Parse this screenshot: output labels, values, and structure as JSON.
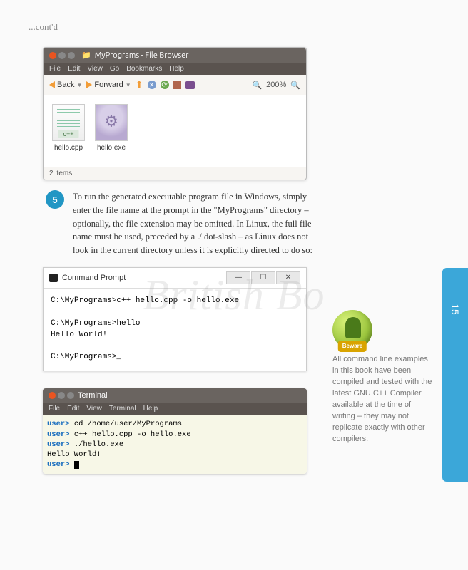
{
  "contd": "...cont'd",
  "page_number": "15",
  "filebrowser": {
    "title": "MyPrograms - File Browser",
    "menu": [
      "File",
      "Edit",
      "View",
      "Go",
      "Bookmarks",
      "Help"
    ],
    "toolbar": {
      "back": "Back",
      "forward": "Forward",
      "zoom_level": "200%"
    },
    "files": [
      {
        "name": "hello.cpp",
        "type": "cpp"
      },
      {
        "name": "hello.exe",
        "type": "exe"
      }
    ],
    "status": "2 items"
  },
  "step": {
    "number": "5",
    "text": "To run the generated executable program file in Windows, simply enter the file name at the prompt in the \"MyPrograms\" directory – optionally, the file extension may be omitted. In Linux, the full file name must be used, preceded by a ./ dot-slash – as Linux does not look in the current directory unless it is explicitly directed to do so:"
  },
  "cmdprompt": {
    "title": "Command Prompt",
    "lines": [
      "C:\\MyPrograms>c++ hello.cpp -o hello.exe",
      "",
      "C:\\MyPrograms>hello",
      "Hello World!",
      "",
      "C:\\MyPrograms>_"
    ]
  },
  "terminal": {
    "title": "Terminal",
    "menu": [
      "File",
      "Edit",
      "View",
      "Terminal",
      "Help"
    ],
    "lines": [
      {
        "prompt": "user>",
        "cmd": " cd /home/user/MyPrograms"
      },
      {
        "prompt": "user>",
        "cmd": " c++ hello.cpp -o hello.exe"
      },
      {
        "prompt": "user>",
        "cmd": " ./hello.exe"
      },
      {
        "prompt": "",
        "cmd": "Hello World!"
      },
      {
        "prompt": "user>",
        "cmd": ""
      }
    ]
  },
  "beware": {
    "label": "Beware",
    "text": "All command line examples in this book have been compiled and tested with the latest GNU C++ Compiler available at the time of writing – they may not replicate exactly with other compilers."
  },
  "watermark": "British Bo"
}
